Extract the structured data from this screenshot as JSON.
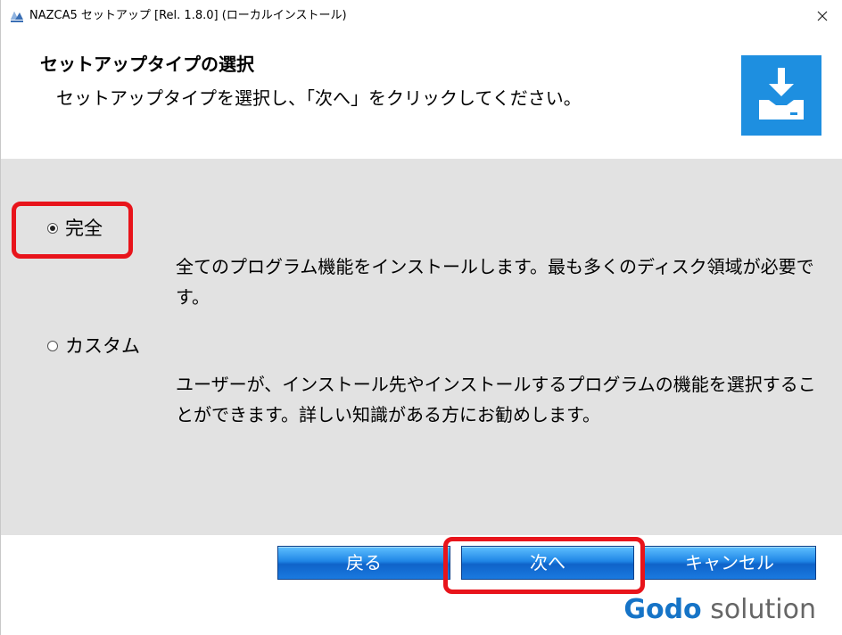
{
  "window": {
    "title": "NAZCA5 セットアップ [Rel. 1.8.0] (ローカルインストール)"
  },
  "header": {
    "title": "セットアップタイプの選択",
    "subtitle": "セットアップタイプを選択し、「次へ」をクリックしてください。",
    "icon": "install-download-icon"
  },
  "options": [
    {
      "label": "完全",
      "selected": true,
      "description": "全てのプログラム機能をインストールします。最も多くのディスク領域が必要です。"
    },
    {
      "label": "カスタム",
      "selected": false,
      "description": "ユーザーが、インストール先やインストールするプログラムの機能を選択することができます。詳しい知識がある方にお勧めします。"
    }
  ],
  "buttons": {
    "back": "戻る",
    "next": "次へ",
    "cancel": "キャンセル"
  },
  "brand": {
    "part1": "Godo",
    "part2": " solution"
  },
  "colors": {
    "accent": "#1e8fe0",
    "highlight": "#e8141b",
    "content_bg": "#e2e2e2"
  }
}
